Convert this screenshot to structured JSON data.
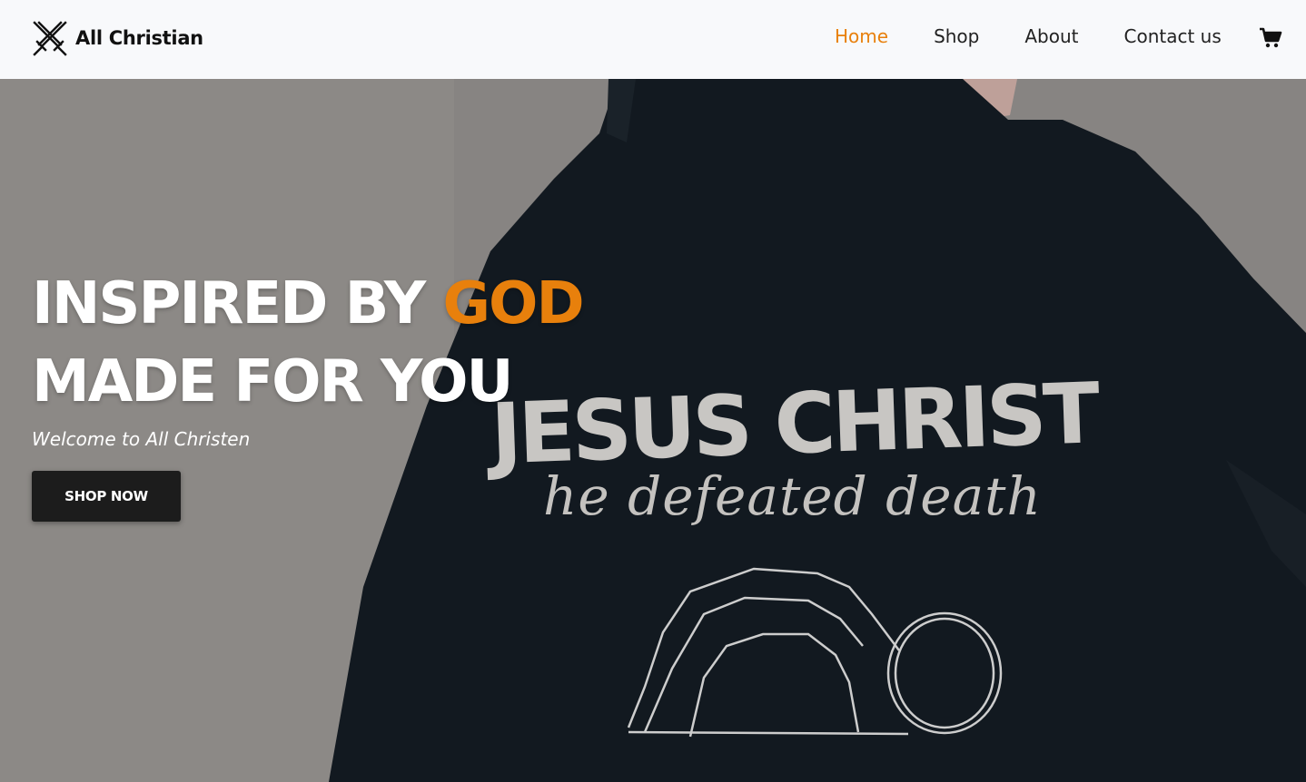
{
  "brand": {
    "name": "All Christian",
    "logo_icon": "crossed-swords-icon"
  },
  "nav": {
    "items": [
      {
        "label": "Home",
        "active": true
      },
      {
        "label": "Shop",
        "active": false
      },
      {
        "label": "About",
        "active": false
      },
      {
        "label": "Contact us",
        "active": false
      }
    ],
    "cart_icon": "cart-icon"
  },
  "hero": {
    "headline_line1_white": "INSPIRED BY ",
    "headline_line1_accent": "GOD",
    "headline_line2": "MADE FOR YOU",
    "welcome": "Welcome to All Christen",
    "button_label": "SHOP NOW",
    "shirt_print_title": "JESUS CHRIST",
    "shirt_print_script": "he defeated death"
  },
  "colors": {
    "accent": "#e8800c",
    "header_bg": "#f8f9fb",
    "button_bg": "#1c1c1c",
    "hoodie": "#141b22"
  }
}
